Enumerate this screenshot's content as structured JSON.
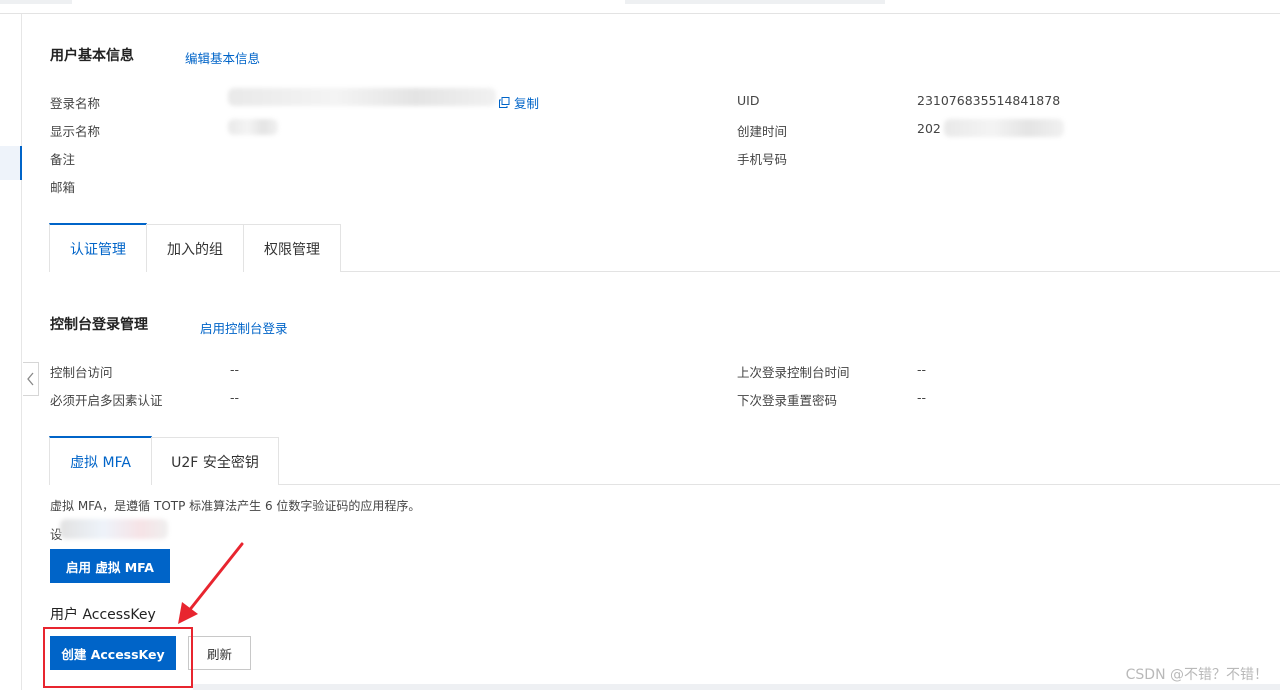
{
  "basic": {
    "title": "用户基本信息",
    "edit_link": "编辑基本信息",
    "login_name_label": "登录名称",
    "copy_link": "复制",
    "display_name_label": "显示名称",
    "remark_label": "备注",
    "email_label": "邮箱",
    "uid_label": "UID",
    "uid_value": "231076835514841878",
    "created_label": "创建时间",
    "created_value_prefix": "202",
    "phone_label": "手机号码"
  },
  "main_tabs": [
    "认证管理",
    "加入的组",
    "权限管理"
  ],
  "console": {
    "title": "控制台登录管理",
    "enable_link": "启用控制台登录",
    "access_label": "控制台访问",
    "access_value": "--",
    "mfa_required_label": "必须开启多因素认证",
    "mfa_required_value": "--",
    "last_login_label": "上次登录控制台时间",
    "last_login_value": "--",
    "reset_pwd_label": "下次登录重置密码",
    "reset_pwd_value": "--"
  },
  "mfa_tabs": [
    "虚拟 MFA",
    "U2F 安全密钥"
  ],
  "mfa": {
    "description": "虚拟 MFA，是遵循 TOTP 标准算法产生 6 位数字验证码的应用程序。",
    "status_prefix": "设",
    "enable_button": "启用 虚拟 MFA"
  },
  "accesskey": {
    "title": "用户 AccessKey",
    "create_button": "创建 AccessKey",
    "refresh_button": "刷新"
  },
  "watermark": "CSDN @不错？不错！",
  "colors": {
    "primary": "#0064c8",
    "highlight": "#e8252f"
  },
  "icons": {
    "copy": "copy-icon",
    "collapse": "chevron-left-icon",
    "annotation": "red-arrow"
  }
}
